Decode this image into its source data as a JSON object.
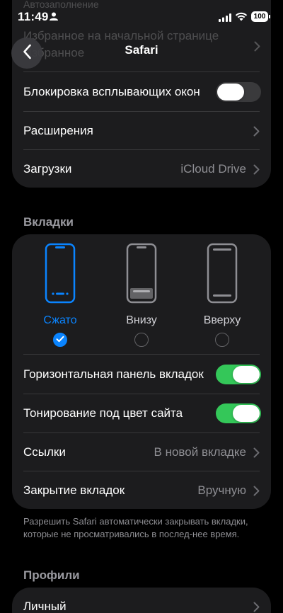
{
  "status_bar": {
    "time": "11:49",
    "battery": "100"
  },
  "nav": {
    "title": "Safari",
    "back_icon": "chevron-left-icon"
  },
  "ghost": {
    "line1": "Автозаполнение",
    "line2": "Избранное на начальной странице",
    "line3": "Избранное"
  },
  "general": {
    "popup_blocker_label": "Блокировка всплывающих окон",
    "popup_blocker_on": false,
    "extensions_label": "Расширения",
    "downloads_label": "Загрузки",
    "downloads_value": "iCloud Drive"
  },
  "tabs_section": {
    "header": "Вкладки",
    "layouts": [
      {
        "label": "Сжато",
        "selected": true
      },
      {
        "label": "Внизу",
        "selected": false
      },
      {
        "label": "Вверху",
        "selected": false
      }
    ],
    "landscape_tab_bar_label": "Горизонтальная панель вкладок",
    "landscape_tab_bar_on": true,
    "tinting_label": "Тонирование под цвет сайта",
    "tinting_on": true,
    "links_label": "Ссылки",
    "links_value": "В новой вкладке",
    "close_tabs_label": "Закрытие вкладок",
    "close_tabs_value": "Вручную",
    "footer": "Разрешить Safari автоматически закрывать вкладки, которые не просматривались в послед-нее время."
  },
  "profiles_section": {
    "header": "Профили",
    "item_label": "Личный"
  },
  "colors": {
    "accent": "#0a84ff",
    "toggle_on": "#34c759",
    "card": "#1c1c1e",
    "background": "#000000"
  }
}
